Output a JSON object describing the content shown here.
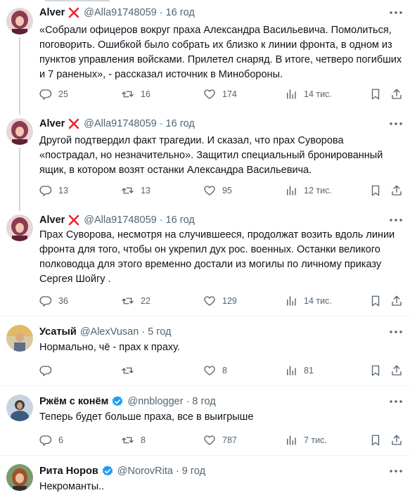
{
  "tweets": [
    {
      "name": "Alver",
      "handle": "@Alla91748059",
      "time": "16 год",
      "text": "«Собрали офицеров вокруг праха Александра Васильевича. Помолиться, поговорить. Ошибкой было собрать их близко к линии фронта, в одном из пунктов управления войсками. Прилетел снаряд. В итоге, четверо погибших и 7 раненых», - рассказал  источник в Минобороны.",
      "stats": {
        "replies": "25",
        "retweets": "16",
        "likes": "174",
        "views": "14 тис."
      },
      "avatar_bg": "#8e3b52"
    },
    {
      "name": "Alver",
      "handle": "@Alla91748059",
      "time": "16 год",
      "text": "Другой подтвердил факт трагедии. И сказал, что прах Суворова «пострадал, но незначительно». Защитил специальный бронированный ящик, в котором возят останки Александра Васильевича.",
      "stats": {
        "replies": "13",
        "retweets": "13",
        "likes": "95",
        "views": "12 тис."
      },
      "avatar_bg": "#8e3b52"
    },
    {
      "name": "Alver",
      "handle": "@Alla91748059",
      "time": "16 год",
      "text": "Прах Суворова, несмотря на случившееся, продолжат возить вдоль линии фронта для того, чтобы он укрепил дух рос. военных. Останки великого полководца для этого временно достали из могилы по личному приказу Сергея Шойгу .",
      "stats": {
        "replies": "36",
        "retweets": "22",
        "likes": "129",
        "views": "14 тис."
      },
      "avatar_bg": "#8e3b52"
    },
    {
      "name": "Усатый",
      "handle": "@AlexVusan",
      "time": "5 год",
      "text": "Нормально, чё - прах к праху.",
      "stats": {
        "replies": "",
        "retweets": "",
        "likes": "8",
        "views": "81"
      },
      "avatar_bg": "#c9a15a"
    },
    {
      "name": "Ржём с конём",
      "handle": "@nnblogger",
      "time": "8 год",
      "text": "Теперь будет больше праха, все в выигрыше",
      "stats": {
        "replies": "6",
        "retweets": "8",
        "likes": "787",
        "views": "7 тис."
      },
      "avatar_bg": "#3d5a80"
    },
    {
      "name": "Рита Норов",
      "handle": "@NorovRita",
      "time": "9 год",
      "text": "Некроманты..",
      "stats": {
        "replies": "",
        "retweets": "",
        "likes": "",
        "views": ""
      },
      "avatar_bg": "#a0522d"
    }
  ],
  "icons": {
    "more": "more-icon",
    "reply": "reply-icon",
    "retweet": "retweet-icon",
    "like": "like-icon",
    "views": "views-icon",
    "bookmark": "bookmark-icon",
    "share": "share-icon",
    "x_mark": "red-x-icon",
    "verified": "verified-badge-icon"
  },
  "colors": {
    "text": "#0f1419",
    "secondary": "#536471",
    "verified": "#1d9bf0",
    "x_mark": "#f4212e",
    "divider": "#eff3f4"
  }
}
